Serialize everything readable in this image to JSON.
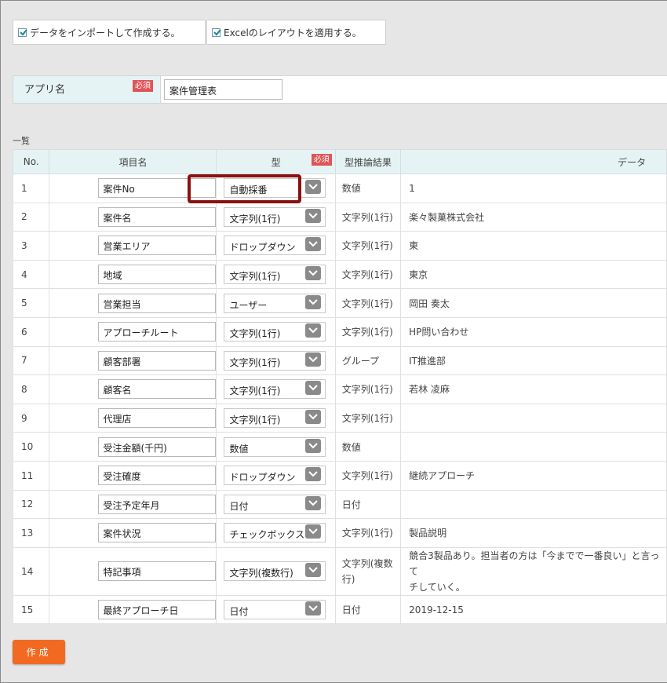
{
  "options": {
    "import_data_label": "データをインポートして作成する。",
    "excel_layout_label": "Excelのレイアウトを適用する。"
  },
  "app": {
    "name_label": "アプリ名",
    "required_badge": "必須",
    "name_value": "案件管理表"
  },
  "list": {
    "title": "一覧",
    "headers": {
      "no": "No.",
      "field_name": "項目名",
      "type": "型",
      "type_required": "必須",
      "inferred": "型推論結果",
      "data": "データ"
    },
    "rows": [
      {
        "no": "1",
        "name": "案件No",
        "type": "自動採番",
        "inferred": "数値",
        "data": "1"
      },
      {
        "no": "2",
        "name": "案件名",
        "type": "文字列(1行)",
        "inferred": "文字列(1行)",
        "data": "楽々製菓株式会社"
      },
      {
        "no": "3",
        "name": "営業エリア",
        "type": "ドロップダウン",
        "inferred": "文字列(1行)",
        "data": "東"
      },
      {
        "no": "4",
        "name": "地域",
        "type": "文字列(1行)",
        "inferred": "文字列(1行)",
        "data": "東京"
      },
      {
        "no": "5",
        "name": "営業担当",
        "type": "ユーザー",
        "inferred": "文字列(1行)",
        "data": "岡田 奏太"
      },
      {
        "no": "6",
        "name": "アプローチルート",
        "type": "文字列(1行)",
        "inferred": "文字列(1行)",
        "data": "HP問い合わせ"
      },
      {
        "no": "7",
        "name": "顧客部署",
        "type": "文字列(1行)",
        "inferred": "グループ",
        "data": "IT推進部"
      },
      {
        "no": "8",
        "name": "顧客名",
        "type": "文字列(1行)",
        "inferred": "文字列(1行)",
        "data": "若林 凌麻"
      },
      {
        "no": "9",
        "name": "代理店",
        "type": "文字列(1行)",
        "inferred": "文字列(1行)",
        "data": ""
      },
      {
        "no": "10",
        "name": "受注金額(千円)",
        "type": "数値",
        "inferred": "数値",
        "data": ""
      },
      {
        "no": "11",
        "name": "受注確度",
        "type": "ドロップダウン",
        "inferred": "文字列(1行)",
        "data": "継続アプローチ"
      },
      {
        "no": "12",
        "name": "受注予定年月",
        "type": "日付",
        "inferred": "日付",
        "data": ""
      },
      {
        "no": "13",
        "name": "案件状況",
        "type": "チェックボックス",
        "inferred": "文字列(1行)",
        "data": "製品説明"
      },
      {
        "no": "14",
        "name": "特記事項",
        "type": "文字列(複数行)",
        "inferred": "文字列(複数行)",
        "data": "競合3製品あり。担当者の方は「今までで一番良い」と言って\nチしていく。"
      },
      {
        "no": "15",
        "name": "最終アプローチ日",
        "type": "日付",
        "inferred": "日付",
        "data": "2019-12-15"
      }
    ]
  },
  "create_button": "作成"
}
